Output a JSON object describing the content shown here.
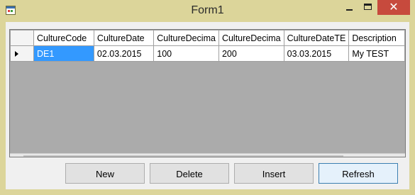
{
  "window": {
    "title": "Form1",
    "close_glyph": "✕"
  },
  "grid": {
    "columns": [
      "CultureCode",
      "CultureDate",
      "CultureDecima",
      "CultureDecima",
      "CultureDateTE",
      "Description"
    ],
    "rows": [
      {
        "current": true,
        "cells": [
          "DE1",
          "02.03.2015",
          "100",
          "200",
          "03.03.2015",
          "My TEST"
        ],
        "selected_cell": 0
      }
    ],
    "scroll": {
      "left_glyph": "<",
      "right_glyph": ">"
    }
  },
  "buttons": {
    "new": "New",
    "delete": "Delete",
    "insert": "Insert",
    "refresh": "Refresh"
  },
  "colors": {
    "titlebar": "#dcd59a",
    "close_button": "#c74a3d",
    "selection": "#3399ff",
    "grid_background": "#ababab"
  },
  "icons": [
    "app-form-icon",
    "minimize-icon",
    "maximize-icon",
    "close-icon",
    "row-indicator-arrow-icon",
    "scroll-left-icon",
    "scroll-right-icon"
  ]
}
